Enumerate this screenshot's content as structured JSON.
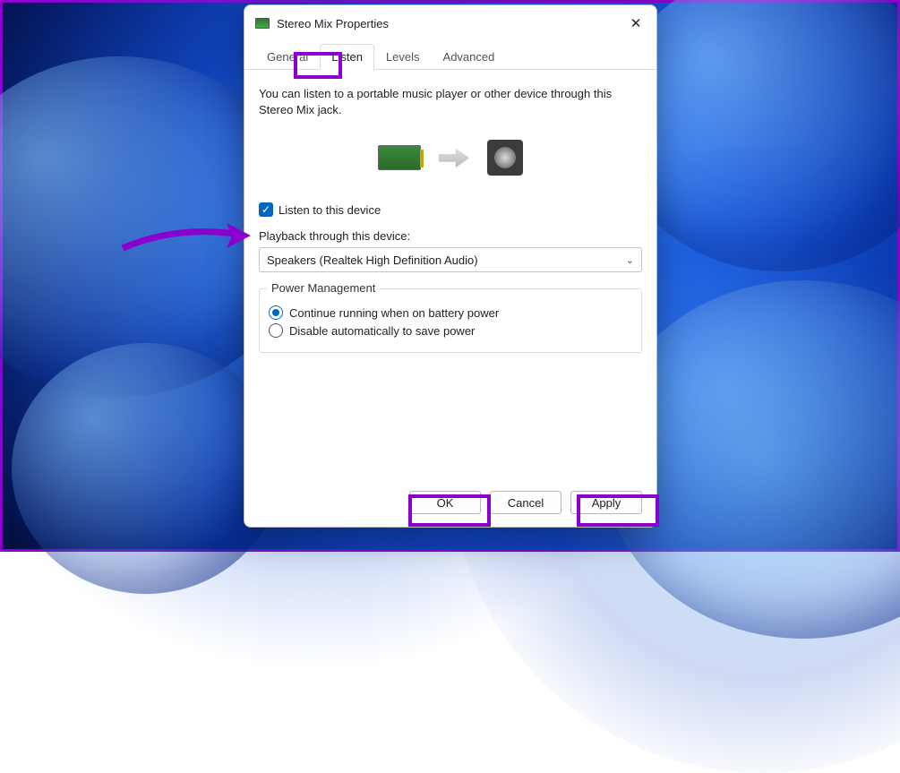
{
  "window": {
    "title": "Stereo Mix Properties"
  },
  "tabs": {
    "general": "General",
    "listen": "Listen",
    "levels": "Levels",
    "advanced": "Advanced"
  },
  "listen_panel": {
    "description": "You can listen to a portable music player or other device through this Stereo Mix jack.",
    "checkbox_label": "Listen to this device",
    "playback_label": "Playback through this device:",
    "playback_selected": "Speakers (Realtek High Definition Audio)"
  },
  "power": {
    "legend": "Power Management",
    "opt_continue": "Continue running when on battery power",
    "opt_disable": "Disable automatically to save power"
  },
  "buttons": {
    "ok": "OK",
    "cancel": "Cancel",
    "apply": "Apply"
  }
}
